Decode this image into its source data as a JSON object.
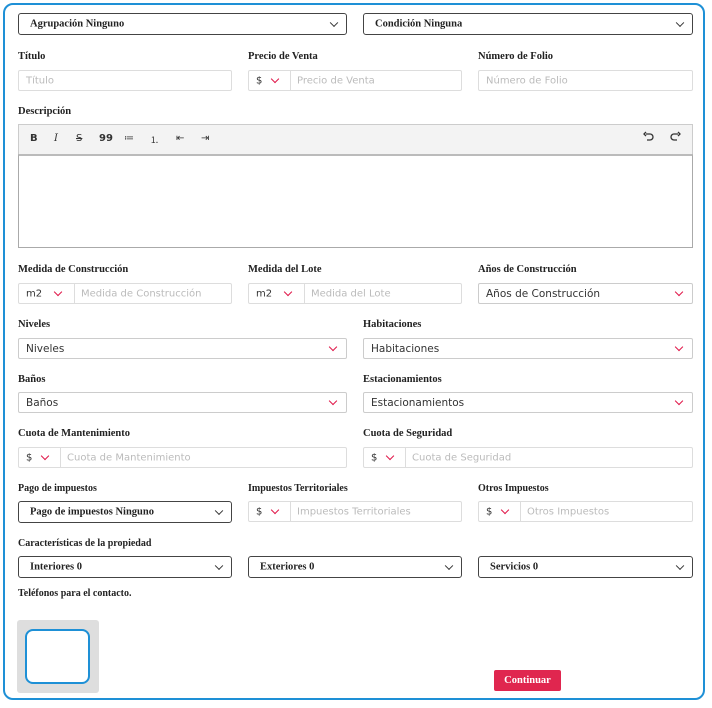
{
  "top": {
    "agrupacion": "Agrupación Ninguno",
    "condicion": "Condición Ninguna"
  },
  "titulo": {
    "label": "Título",
    "placeholder": "Título"
  },
  "precio": {
    "label": "Precio de Venta",
    "currency": "$",
    "placeholder": "Precio de Venta"
  },
  "folio": {
    "label": "Número de Folio",
    "placeholder": "Número de Folio"
  },
  "descripcion": {
    "label": "Descripción",
    "toolbar": [
      "B",
      "I",
      "S",
      "99",
      "≔",
      "⒈",
      "⇤",
      "⇥"
    ]
  },
  "construccion": {
    "label": "Medida de Construcción",
    "unit": "m2",
    "placeholder": "Medida de Construcción"
  },
  "lote": {
    "label": "Medida del Lote",
    "unit": "m2",
    "placeholder": "Medida del Lote"
  },
  "anios": {
    "label": "Años de Construcción",
    "value": "Años de Construcción"
  },
  "niveles": {
    "label": "Niveles",
    "value": "Niveles"
  },
  "habitaciones": {
    "label": "Habitaciones",
    "value": "Habitaciones"
  },
  "banos": {
    "label": "Baños",
    "value": "Baños"
  },
  "estacionamientos": {
    "label": "Estacionamientos",
    "value": "Estacionamientos"
  },
  "mantenimiento": {
    "label": "Cuota de Mantenimiento",
    "currency": "$",
    "placeholder": "Cuota de Mantenimiento"
  },
  "seguridad": {
    "label": "Cuota de Seguridad",
    "currency": "$",
    "placeholder": "Cuota de Seguridad"
  },
  "pago": {
    "label": "Pago de impuestos",
    "value": "Pago de impuestos Ninguno"
  },
  "territoriales": {
    "label": "Impuestos Territoriales",
    "currency": "$",
    "placeholder": "Impuestos Territoriales"
  },
  "otros": {
    "label": "Otros Impuestos",
    "currency": "$",
    "placeholder": "Otros Impuestos"
  },
  "caracteristicas": {
    "label": "Características de la propiedad",
    "interiores": "Interiores 0",
    "exteriores": "Exteriores 0",
    "servicios": "Servicios 0"
  },
  "telefonos": {
    "label": "Teléfonos para el contacto."
  },
  "continuar": "Continuar",
  "colors": {
    "accent": "#e0264f",
    "frame": "#1e90d6"
  }
}
